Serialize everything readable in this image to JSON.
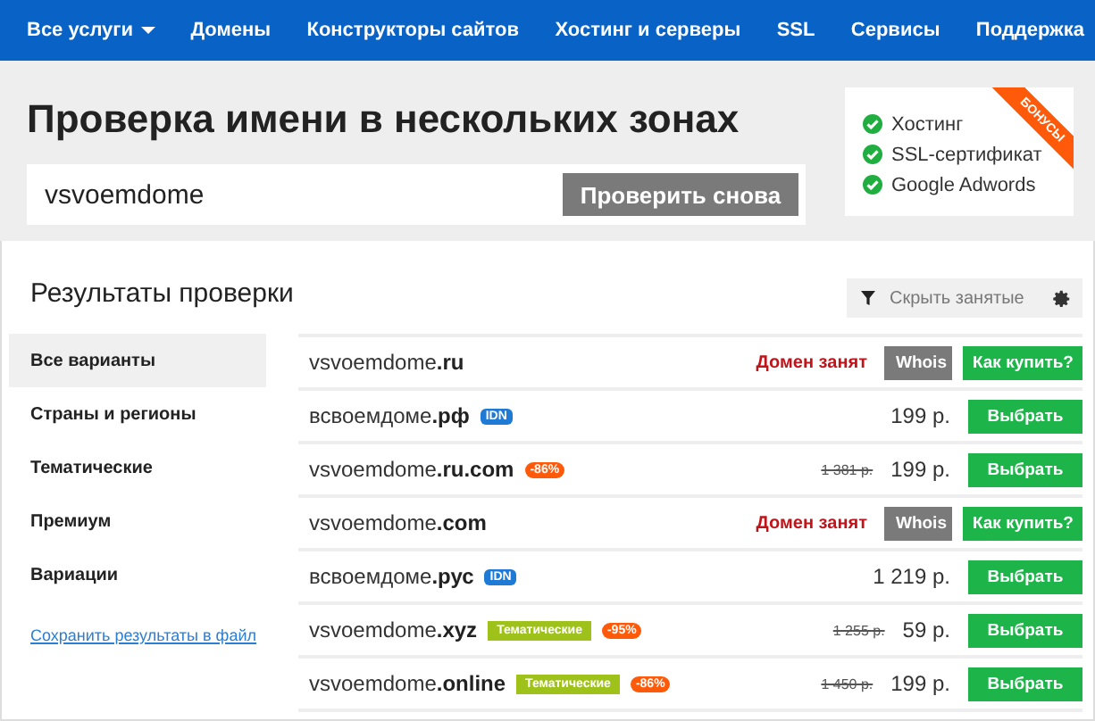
{
  "nav": [
    {
      "label": "Все услуги",
      "dropdown": true
    },
    {
      "label": "Домены",
      "dropdown": false
    },
    {
      "label": "Конструкторы сайтов",
      "dropdown": false
    },
    {
      "label": "Хостинг и серверы",
      "dropdown": false
    },
    {
      "label": "SSL",
      "dropdown": false
    },
    {
      "label": "Сервисы",
      "dropdown": false
    },
    {
      "label": "Поддержка",
      "dropdown": false
    }
  ],
  "title": "Проверка имени в нескольких зонах",
  "search": {
    "value": "vsvoemdome",
    "button": "Проверить снова"
  },
  "bonuses": {
    "ribbon": "БОНУСЫ",
    "items": [
      "Хостинг",
      "SSL-сертификат",
      "Google Adwords"
    ]
  },
  "results_title": "Результаты проверки",
  "filter": {
    "label": "Скрыть занятые"
  },
  "sidebar": {
    "items": [
      {
        "label": "Все варианты",
        "selected": true
      },
      {
        "label": "Страны и регионы",
        "selected": false
      },
      {
        "label": "Тематические",
        "selected": false
      },
      {
        "label": "Премиум",
        "selected": false
      },
      {
        "label": "Вариации",
        "selected": false
      }
    ],
    "link": "Сохранить результаты в файл"
  },
  "rows": [
    {
      "kind": "taken",
      "name": "vsvoemdome",
      "tld": ".ru",
      "tags": [],
      "status": "Домен занят",
      "buttons": [
        "Whois",
        "Как купить?"
      ]
    },
    {
      "kind": "available",
      "name": "всвоемдоме",
      "tld": ".рф",
      "tags": [
        {
          "kind": "idn",
          "text": "IDN"
        }
      ],
      "price": "199 р.",
      "buttons": [
        "Выбрать"
      ]
    },
    {
      "kind": "available",
      "name": "vsvoemdome",
      "tld": ".ru.com",
      "tags": [
        {
          "kind": "discount",
          "text": "-86%"
        }
      ],
      "old_price": "1 381 р.",
      "price": "199 р.",
      "buttons": [
        "Выбрать"
      ]
    },
    {
      "kind": "taken",
      "name": "vsvoemdome",
      "tld": ".com",
      "tags": [],
      "status": "Домен занят",
      "buttons": [
        "Whois",
        "Как купить?"
      ]
    },
    {
      "kind": "available",
      "name": "всвоемдоме",
      "tld": ".рус",
      "tags": [
        {
          "kind": "idn",
          "text": "IDN"
        }
      ],
      "price": "1 219 р.",
      "buttons": [
        "Выбрать"
      ]
    },
    {
      "kind": "available",
      "name": "vsvoemdome",
      "tld": ".xyz",
      "tags": [
        {
          "kind": "category",
          "text": "Тематические"
        },
        {
          "kind": "discount",
          "text": "-95%"
        }
      ],
      "old_price": "1 255 р.",
      "price": "59 р.",
      "buttons": [
        "Выбрать"
      ]
    },
    {
      "kind": "available",
      "name": "vsvoemdome",
      "tld": ".online",
      "tags": [
        {
          "kind": "category",
          "text": "Тематические"
        },
        {
          "kind": "discount",
          "text": "-86%"
        }
      ],
      "old_price": "1 450 р.",
      "price": "199 р.",
      "buttons": [
        "Выбрать"
      ]
    }
  ]
}
